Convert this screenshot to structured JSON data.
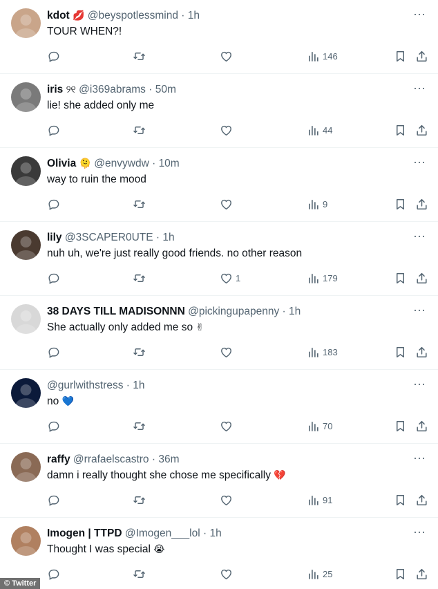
{
  "icons": {
    "reply": "reply-icon",
    "retweet": "retweet-icon",
    "like": "heart-icon",
    "views": "views-icon",
    "bookmark": "bookmark-icon",
    "share": "share-icon",
    "more": "more-icon"
  },
  "colors": {
    "text": "#0f1419",
    "secondary": "#536471",
    "divider": "#eff3f4"
  },
  "tweets": [
    {
      "name": "kdot",
      "name_emoji": "💋",
      "handle": "@beyspotlessmind",
      "sep": "·",
      "time": "1h",
      "text": "TOUR WHEN?!",
      "text_emoji": "",
      "replies": "",
      "retweets": "",
      "likes": "",
      "views": "146",
      "avatar_color": "#c9a58a"
    },
    {
      "name": "iris",
      "name_emoji": "୨୧",
      "handle": "@i369abrams",
      "sep": "·",
      "time": "50m",
      "text": "lie! she added only me",
      "text_emoji": "",
      "replies": "",
      "retweets": "",
      "likes": "",
      "views": "44",
      "avatar_color": "#7a7a7a"
    },
    {
      "name": "Olivia",
      "name_emoji": "🫠",
      "handle": "@envywdw",
      "sep": "·",
      "time": "10m",
      "text": "way to ruin the mood",
      "text_emoji": "",
      "replies": "",
      "retweets": "",
      "likes": "",
      "views": "9",
      "avatar_color": "#3a3a3a"
    },
    {
      "name": "lily",
      "name_emoji": "",
      "handle": "@3SCAPER0UTE",
      "sep": "·",
      "time": "1h",
      "text": "nuh uh, we're just really good friends. no other reason",
      "text_emoji": "",
      "replies": "",
      "retweets": "",
      "likes": "1",
      "views": "179",
      "avatar_color": "#4a3a30"
    },
    {
      "name": "38 DAYS TILL MADISONNN",
      "name_emoji": "",
      "handle": "@pickingupapenny",
      "sep": "·",
      "time": "1h",
      "text": "She actually only added me so",
      "text_emoji": "✌",
      "replies": "",
      "retweets": "",
      "likes": "",
      "views": "183",
      "avatar_color": "#d8d8d8"
    },
    {
      "name": "",
      "name_emoji": "",
      "handle": "@gurlwithstress",
      "sep": "·",
      "time": "1h",
      "text": "no",
      "text_emoji": "💙",
      "replies": "",
      "retweets": "",
      "likes": "",
      "views": "70",
      "avatar_color": "#0b1a3a"
    },
    {
      "name": "raffy",
      "name_emoji": "",
      "handle": "@rrafaelscastro",
      "sep": "·",
      "time": "36m",
      "text": "damn i really thought she chose me specifically",
      "text_emoji": "💔",
      "replies": "",
      "retweets": "",
      "likes": "",
      "views": "91",
      "avatar_color": "#8a6a55"
    },
    {
      "name": "Imogen | TTPD",
      "name_emoji": "",
      "handle": "@Imogen___lol",
      "sep": "·",
      "time": "1h",
      "text": "Thought I was special",
      "text_emoji": "😭",
      "replies": "",
      "retweets": "",
      "likes": "",
      "views": "25",
      "avatar_color": "#b08060"
    }
  ],
  "watermark": "© Twitter"
}
